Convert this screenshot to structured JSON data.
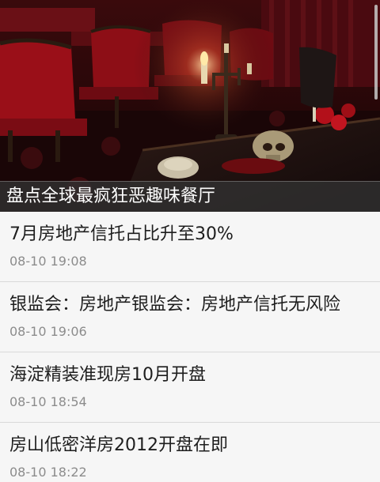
{
  "hero": {
    "caption": "盘点全球最疯狂恶趣味餐厅",
    "image": "restaurant-photo"
  },
  "news": [
    {
      "title": "7月房地产信托占比升至30%",
      "time": "08-10 19:08"
    },
    {
      "title": "银监会：房地产银监会：房地产信托无风险",
      "time": "08-10 19:06"
    },
    {
      "title": "海淀精装准现房10月开盘",
      "time": "08-10 18:54"
    },
    {
      "title": "房山低密洋房2012开盘在即",
      "time": "08-10 18:22"
    }
  ]
}
